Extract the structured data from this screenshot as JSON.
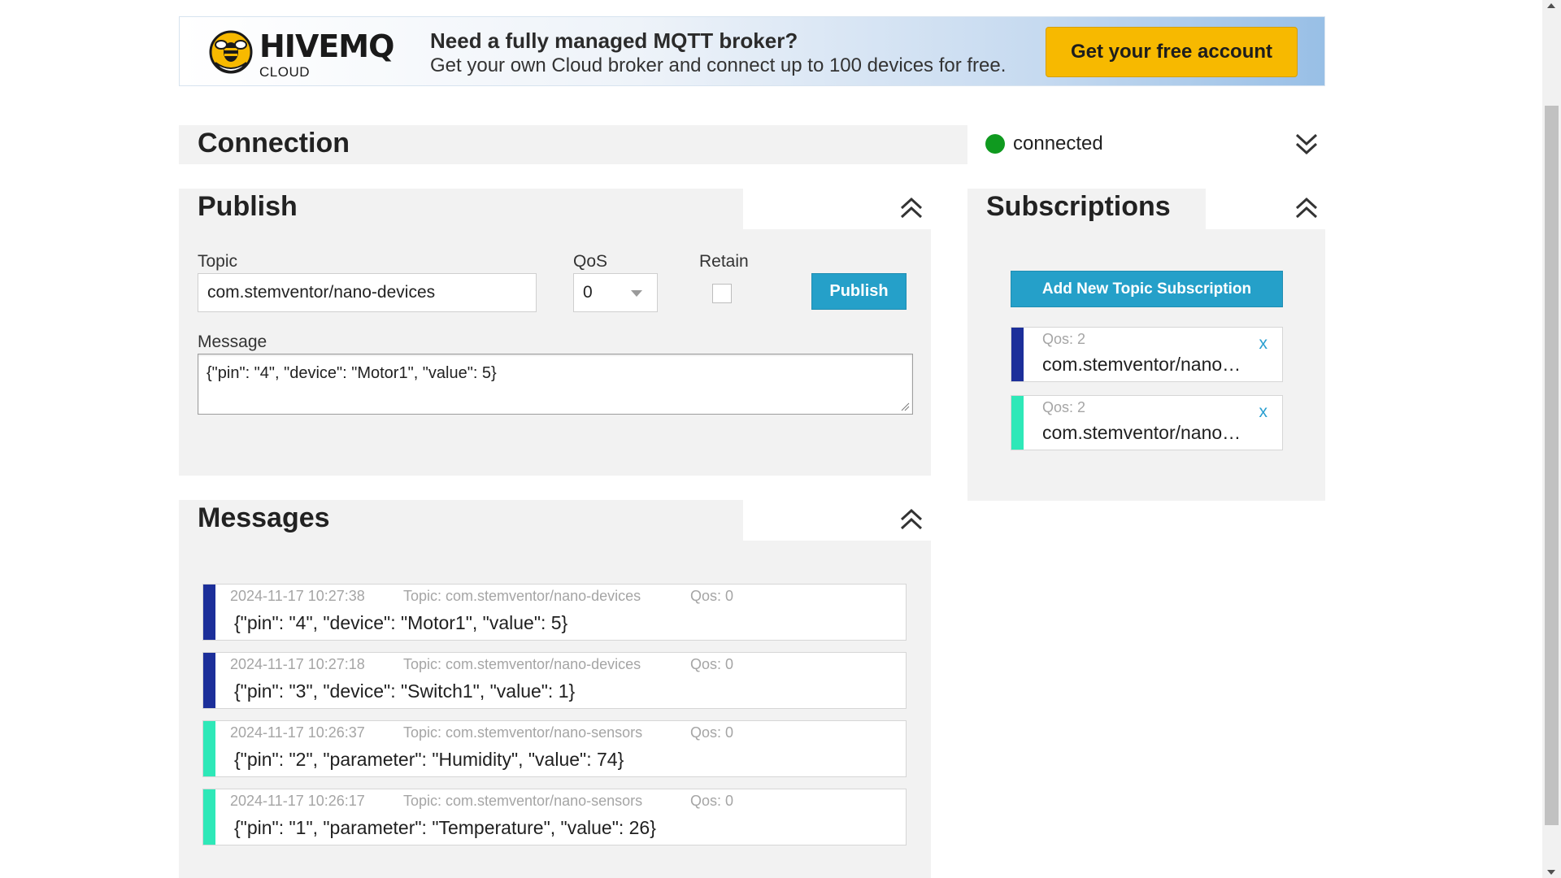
{
  "banner": {
    "logo_text": "HIVEMQ",
    "logo_sub": "CLOUD",
    "headline": "Need a fully managed MQTT broker?",
    "subline": "Get your own Cloud broker and connect up to 100 devices for free.",
    "cta_label": "Get your free account"
  },
  "connection": {
    "title": "Connection",
    "status": "connected",
    "status_color": "#0f9a1f"
  },
  "publish": {
    "title": "Publish",
    "topic_label": "Topic",
    "topic_value": "com.stemventor/nano-devices",
    "qos_label": "QoS",
    "qos_value": "0",
    "retain_label": "Retain",
    "retain_checked": false,
    "publish_label": "Publish",
    "message_label": "Message",
    "message_value": "{\"pin\": \"4\", \"device\": \"Motor1\", \"value\": 5}"
  },
  "messages": {
    "title": "Messages",
    "items": [
      {
        "timestamp": "2024-11-17 10:27:38",
        "topic": "Topic: com.stemventor/nano-devices",
        "qos": "Qos: 0",
        "payload": "{\"pin\": \"4\", \"device\": \"Motor1\", \"value\": 5}",
        "color": "#1c2f9a"
      },
      {
        "timestamp": "2024-11-17 10:27:18",
        "topic": "Topic: com.stemventor/nano-devices",
        "qos": "Qos: 0",
        "payload": "{\"pin\": \"3\", \"device\": \"Switch1\", \"value\": 1}",
        "color": "#1c2f9a"
      },
      {
        "timestamp": "2024-11-17 10:26:37",
        "topic": "Topic: com.stemventor/nano-sensors",
        "qos": "Qos: 0",
        "payload": "{\"pin\": \"2\", \"parameter\": \"Humidity\", \"value\": 74}",
        "color": "#2ee8b8"
      },
      {
        "timestamp": "2024-11-17 10:26:17",
        "topic": "Topic: com.stemventor/nano-sensors",
        "qos": "Qos: 0",
        "payload": "{\"pin\": \"1\", \"parameter\": \"Temperature\", \"value\": 26}",
        "color": "#2ee8b8"
      }
    ]
  },
  "subscriptions": {
    "title": "Subscriptions",
    "add_label": "Add New Topic Subscription",
    "items": [
      {
        "qos": "Qos: 2",
        "topic": "com.stemventor/nano-devices",
        "close": "x",
        "color": "#1c2f9a"
      },
      {
        "qos": "Qos: 2",
        "topic": "com.stemventor/nano-sensors",
        "close": "x",
        "color": "#2ee8b8"
      }
    ]
  },
  "colors": {
    "accent_blue": "#25a0c9",
    "cta_yellow": "#f7b900",
    "panel_bg": "#f2f2f2"
  }
}
